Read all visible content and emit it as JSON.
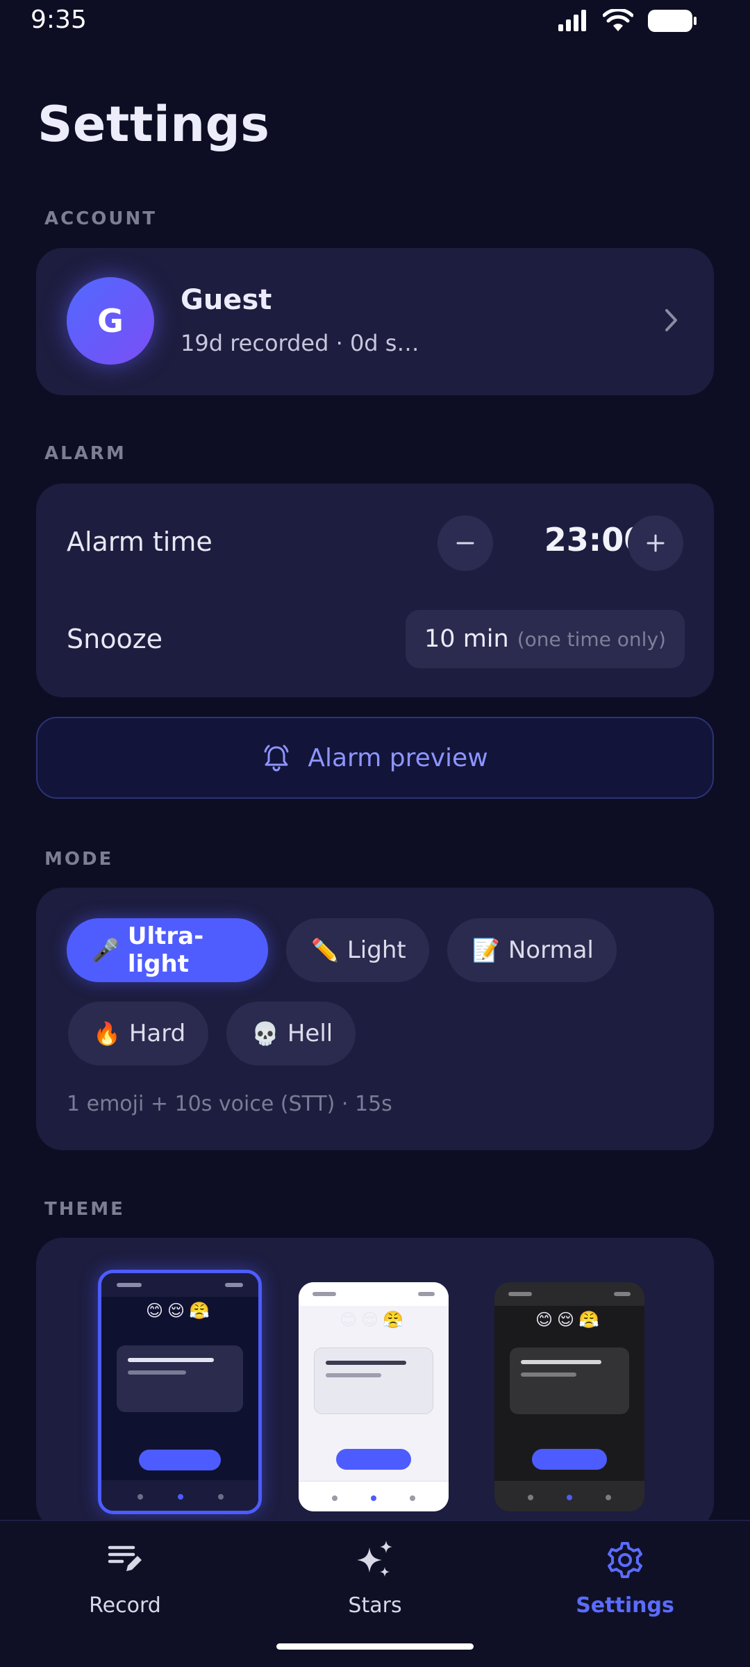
{
  "status_bar": {
    "time": "9:35"
  },
  "page": {
    "title": "Settings"
  },
  "account": {
    "section_label": "ACCOUNT",
    "avatar_initial": "G",
    "name": "Guest",
    "subtitle": "19d recorded · 0d s…"
  },
  "alarm": {
    "section_label": "ALARM",
    "time_label": "Alarm time",
    "time_value": "23:00",
    "snooze_label": "Snooze",
    "snooze_value": "10 min",
    "snooze_note": "(one time only)"
  },
  "preview_button": {
    "label": "Alarm preview",
    "icon": "alarm-bell-icon"
  },
  "mode": {
    "section_label": "MODE",
    "options": [
      {
        "emoji": "🎤",
        "label": "Ultra-light",
        "selected": true
      },
      {
        "emoji": "✏️",
        "label": "Light",
        "selected": false
      },
      {
        "emoji": "📝",
        "label": "Normal",
        "selected": false
      },
      {
        "emoji": "🔥",
        "label": "Hard",
        "selected": false
      },
      {
        "emoji": "💀",
        "label": "Hell",
        "selected": false
      }
    ],
    "description": "1 emoji + 10s voice (STT) · 15s"
  },
  "theme": {
    "section_label": "THEME",
    "preview_emojis": "😊😌😤",
    "options": [
      {
        "name": "dark-navy",
        "selected": true,
        "bg": "#0f1130",
        "card": "#2a2b4d",
        "bar": "#e3e3f2",
        "accent": "#4d5cff"
      },
      {
        "name": "light",
        "selected": false,
        "bg": "#f3f2f8",
        "card": "#e8e8f0",
        "bar": "#3b3c4f",
        "accent": "#4d5cff"
      },
      {
        "name": "dark-gray",
        "selected": false,
        "bg": "#1a1a1c",
        "card": "#333335",
        "bar": "#d6d6d8",
        "accent": "#4d5cff"
      }
    ]
  },
  "bottom_nav": {
    "items": [
      {
        "label": "Record",
        "icon": "record-list-icon",
        "active": false
      },
      {
        "label": "Stars",
        "icon": "sparkles-icon",
        "active": false
      },
      {
        "label": "Settings",
        "icon": "gear-icon",
        "active": true
      }
    ]
  },
  "colors": {
    "accent": "#4f5dff",
    "background": "#0d0e23",
    "card": "#1d1d3f"
  }
}
